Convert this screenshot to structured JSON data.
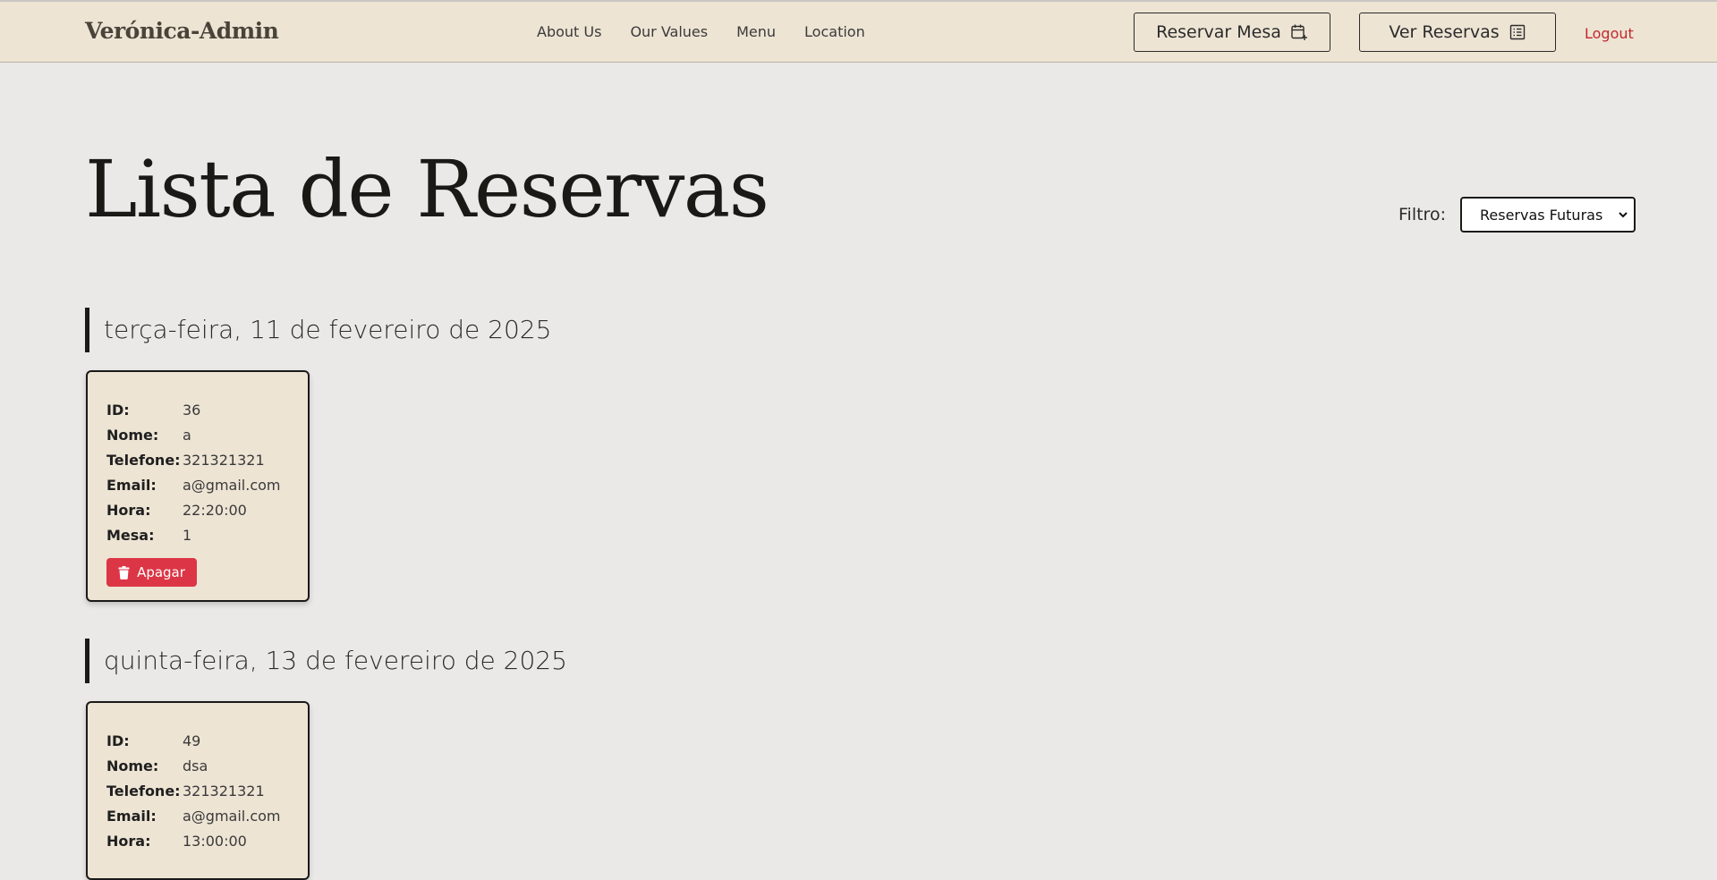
{
  "header": {
    "brand": "Verónica-Admin",
    "nav": [
      "About Us",
      "Our Values",
      "Menu",
      "Location"
    ],
    "reservar_label": "Reservar Mesa",
    "ver_label": "Ver Reservas",
    "logout_label": "Logout"
  },
  "main": {
    "title": "Lista de Reservas",
    "filter_label": "Filtro:",
    "filter_value": "Reservas Futuras",
    "groups": [
      {
        "date": "terça-feira, 11 de fevereiro de 2025",
        "reservation": {
          "fields": [
            {
              "label": "ID:",
              "value": "36"
            },
            {
              "label": "Nome:",
              "value": "a"
            },
            {
              "label": "Telefone:",
              "value": "321321321"
            },
            {
              "label": "Email:",
              "value": "a@gmail.com"
            },
            {
              "label": "Hora:",
              "value": "22:20:00"
            },
            {
              "label": "Mesa:",
              "value": "1"
            }
          ],
          "delete_label": "Apagar"
        }
      },
      {
        "date": "quinta-feira, 13 de fevereiro de 2025",
        "reservation": {
          "fields": [
            {
              "label": "ID:",
              "value": "49"
            },
            {
              "label": "Nome:",
              "value": "dsa"
            },
            {
              "label": "Telefone:",
              "value": "321321321"
            },
            {
              "label": "Email:",
              "value": "a@gmail.com"
            },
            {
              "label": "Hora:",
              "value": "13:00:00"
            }
          ]
        }
      }
    ]
  },
  "colors": {
    "header_bg": "#ede4d4",
    "page_bg": "#ebe9e7",
    "danger": "#dc3545",
    "logout": "#c0282f"
  },
  "icons": {
    "reservar": "calendar-plus-icon",
    "ver": "list-icon",
    "delete": "trash-icon",
    "select": "chevron-down-icon"
  }
}
